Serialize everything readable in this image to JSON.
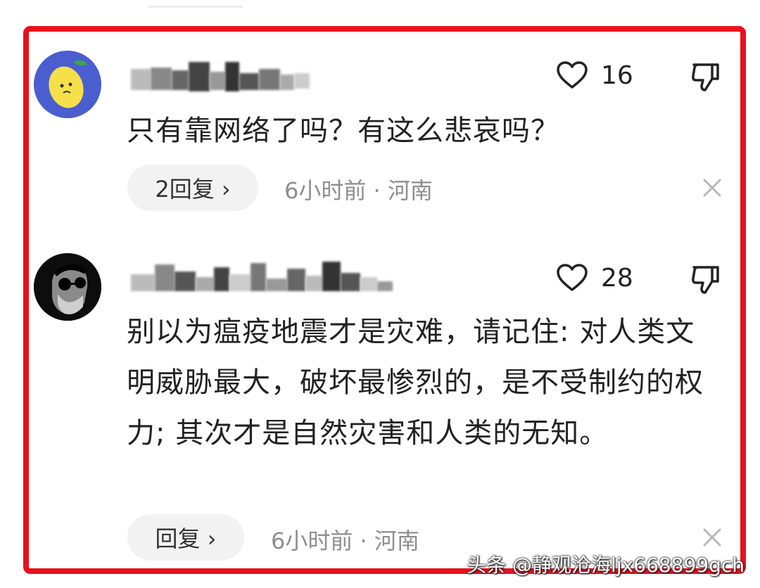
{
  "comments": [
    {
      "text": "只有靠网络了吗？有这么悲哀吗？",
      "likes": "16",
      "reply_label": "2回复 ›",
      "time": "6小时前 · 河南"
    },
    {
      "text": "别以为瘟疫地震才是灾难，请记住: 对人类文明威胁最大，破坏最惨烈的，是不受制约的权力; 其次才是自然灾害和人类的无知。",
      "likes": "28",
      "reply_label": "回复 ›",
      "time": "6小时前 · 河南"
    }
  ],
  "watermark": "头条 @静观沧海ljx668899gch",
  "colors": {
    "frame": "#e8111b",
    "avatar1_bg": "#4a5ed0",
    "lemon": "#f5e04a",
    "pill_bg": "#f2f2f2",
    "meta": "#8e8e8e"
  }
}
